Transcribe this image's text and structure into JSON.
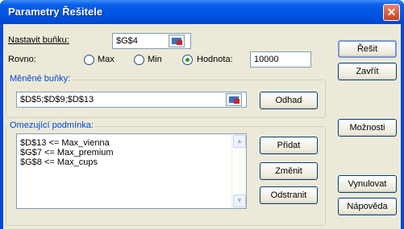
{
  "window": {
    "title": "Parametry Řešitele",
    "close_glyph": "✕"
  },
  "target_cell": {
    "label": "Nastavit buňku:",
    "value": "$G$4"
  },
  "equal_to": {
    "label": "Rovno:",
    "options": [
      {
        "label": "Max",
        "checked": false
      },
      {
        "label": "Min",
        "checked": false
      },
      {
        "label": "Hodnota:",
        "checked": true
      }
    ],
    "value": "10000"
  },
  "changing_cells": {
    "title": "Měněné buňky:",
    "value": "$D$5;$D$9;$D$13",
    "guess_label": "Odhad"
  },
  "constraints": {
    "title": "Omezující podmínka:",
    "items": [
      "$D$13 <= Max_vienna",
      "$G$7 <= Max_premium",
      "$G$8 <= Max_cups"
    ],
    "add_label": "Přidat",
    "change_label": "Změnit",
    "delete_label": "Odstranit"
  },
  "buttons": {
    "solve": "Řešit",
    "close": "Zavřít",
    "options": "Možnosti",
    "reset": "Vynulovat",
    "help": "Nápověda"
  },
  "icons": {
    "close": "close-icon",
    "ref": "cell-reference-icon",
    "scroll_up": "arrow-up-icon",
    "scroll_down": "arrow-down-icon"
  },
  "colors": {
    "titlebar": "#0054e3",
    "dialog_bg": "#ece9d8",
    "group_title": "#0046d5",
    "close_button": "#c9421e"
  }
}
